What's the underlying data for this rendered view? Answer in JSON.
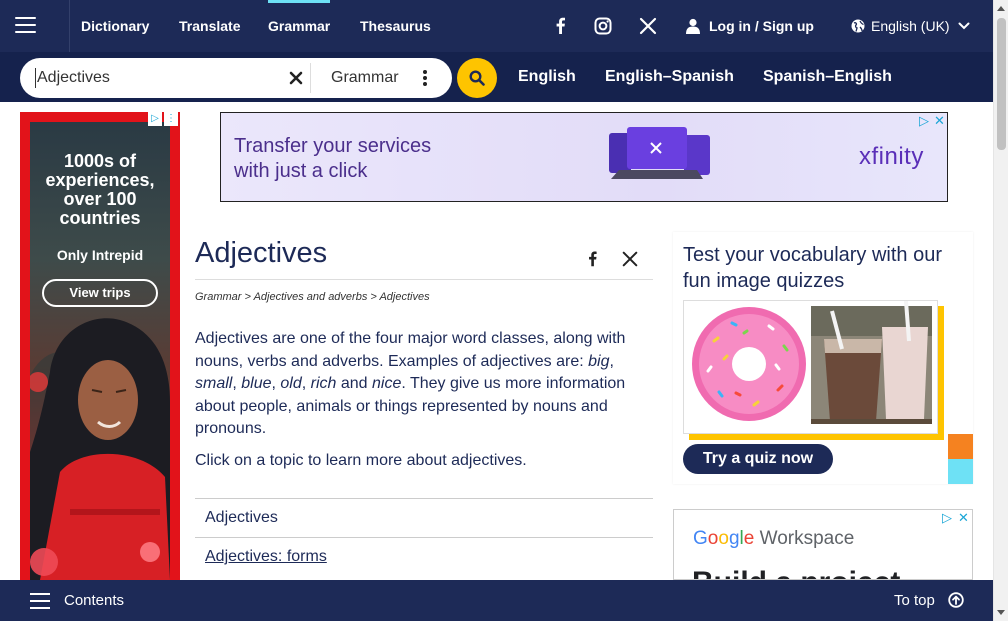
{
  "nav": {
    "items": [
      "Dictionary",
      "Translate",
      "Grammar",
      "Thesaurus"
    ],
    "active": "Grammar",
    "social_icons": [
      "facebook-icon",
      "instagram-icon",
      "x-icon"
    ],
    "login_label": "Log in / Sign up",
    "language_label": "English (UK)",
    "accent_color": "#6ee1f5",
    "background_color": "#1d2a57"
  },
  "search": {
    "query": "Adjectives",
    "dictionary_select": "Grammar",
    "button_color": "#fec400",
    "dictionary_links": [
      "English",
      "English–Spanish",
      "Spanish–English"
    ]
  },
  "left_ad": {
    "headline": "1000s of experiences, over 100 countries",
    "sub": "Only Intrepid",
    "button": "View trips",
    "border_color": "#e2131a"
  },
  "top_ad": {
    "text_line1": "Transfer your services",
    "text_line2": "with just a click",
    "brand": "xfinity",
    "close": "✕"
  },
  "article": {
    "title": "Adjectives",
    "share_icons": [
      "facebook-icon",
      "x-icon"
    ],
    "breadcrumb": [
      "Grammar",
      "Adjectives and adverbs",
      "Adjectives"
    ],
    "breadcrumb_sep": " > ",
    "intro_parts": [
      {
        "t": "Adjectives are one of the four major word classes, along with nouns, verbs and adverbs. Examples of adjectives are: ",
        "i": false
      },
      {
        "t": "big",
        "i": true
      },
      {
        "t": ", ",
        "i": false
      },
      {
        "t": "small",
        "i": true
      },
      {
        "t": ", ",
        "i": false
      },
      {
        "t": "blue",
        "i": true
      },
      {
        "t": ", ",
        "i": false
      },
      {
        "t": "old",
        "i": true
      },
      {
        "t": ", ",
        "i": false
      },
      {
        "t": "rich",
        "i": true
      },
      {
        "t": " and ",
        "i": false
      },
      {
        "t": "nice",
        "i": true
      },
      {
        "t": ". They give us more information about people, animals or things represented by nouns and pronouns.",
        "i": false
      }
    ],
    "prompt": "Click on a topic to learn more about adjectives.",
    "topics": [
      {
        "label": "Adjectives",
        "linked": false
      },
      {
        "label": "Adjectives: forms",
        "linked": true
      }
    ]
  },
  "quiz": {
    "title": "Test your vocabulary with our fun image quizzes",
    "button": "Try a quiz now",
    "images": [
      "donut-image",
      "milkshakes-image"
    ],
    "shadow_color": "#fec400"
  },
  "google_ad": {
    "brand_letters": [
      {
        "c": "G",
        "color": "#4285f4"
      },
      {
        "c": "o",
        "color": "#ea4335"
      },
      {
        "c": "o",
        "color": "#fbbc05"
      },
      {
        "c": "g",
        "color": "#4285f4"
      },
      {
        "c": "l",
        "color": "#34a853"
      },
      {
        "c": "e",
        "color": "#ea4335"
      }
    ],
    "product": " Workspace",
    "headline": "Build a project"
  },
  "bottom": {
    "contents_label": "Contents",
    "to_top_label": "To top"
  }
}
